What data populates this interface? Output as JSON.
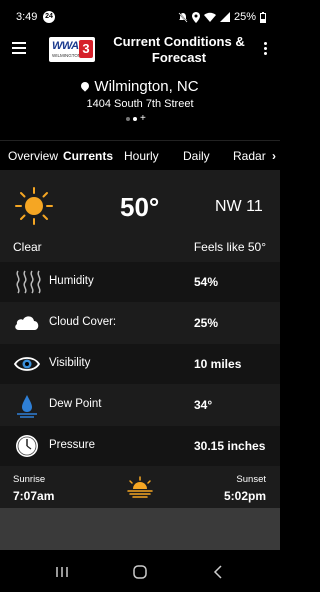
{
  "status": {
    "time": "3:49",
    "badge": "24",
    "battery": "25%"
  },
  "header": {
    "logo_text": "WWAY",
    "logo_sub": "WILMINGTON",
    "logo_mark": "3",
    "title": "Current Conditions & Forecast"
  },
  "location": {
    "city": "Wilmington, NC",
    "address": "1404 South 7th Street",
    "pager_add": "+"
  },
  "tabs": [
    {
      "label": "Overview",
      "active": false
    },
    {
      "label": "Currents",
      "active": true
    },
    {
      "label": "Hourly",
      "active": false
    },
    {
      "label": "Daily",
      "active": false
    },
    {
      "label": "Radar",
      "active": false
    }
  ],
  "current": {
    "temperature": "50°",
    "wind": "NW 11",
    "condition": "Clear",
    "feels_like": "Feels like 50°"
  },
  "details": [
    {
      "label": "Humidity",
      "value": "54%",
      "icon": "humidity-icon"
    },
    {
      "label": "Cloud Cover:",
      "value": "25%",
      "icon": "cloud-icon"
    },
    {
      "label": "Visibility",
      "value": "10 miles",
      "icon": "eye-icon"
    },
    {
      "label": "Dew Point",
      "value": "34°",
      "icon": "droplet-icon"
    },
    {
      "label": "Pressure",
      "value": "30.15 inches",
      "icon": "gauge-icon"
    }
  ],
  "sun": {
    "sunrise_label": "Sunrise",
    "sunrise_time": "7:07am",
    "sunset_label": "Sunset",
    "sunset_time": "5:02pm"
  },
  "colors": {
    "sun_orange": "#f5a623",
    "panel_bg": "#1c1c1c",
    "logo_red": "#d6202a",
    "logo_blue": "#1b3a8e"
  }
}
